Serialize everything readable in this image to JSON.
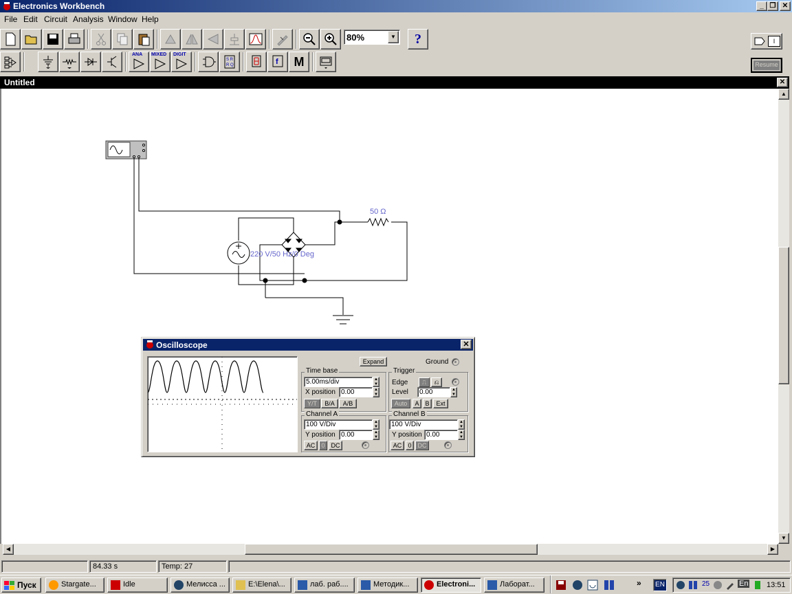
{
  "app": {
    "title": "Electronics Workbench"
  },
  "menu": [
    "File",
    "Edit",
    "Circuit",
    "Analysis",
    "Window",
    "Help"
  ],
  "toolbar": {
    "zoom": "80%",
    "help_label": "?",
    "resume_label": "Resume",
    "power_label": "I"
  },
  "parts_bin": {
    "analog_label": "ANA",
    "mixed_label": "MIXED",
    "digital_label": "DIGIT",
    "misc_label": "M"
  },
  "document": {
    "title": "Untitled"
  },
  "circuit": {
    "resistor_label": "50 Ω",
    "source_label": "220 V/50 Hz/0 Deg"
  },
  "oscilloscope": {
    "title": "Oscilloscope",
    "expand_label": "Expand",
    "ground_label": "Ground",
    "timebase": {
      "label": "Time base",
      "value": "5.00ms/div",
      "xpos_label": "X position",
      "xpos": "0.00",
      "modes": [
        "Y/T",
        "B/A",
        "A/B"
      ]
    },
    "trigger": {
      "label": "Trigger",
      "edge_label": "Edge",
      "level_label": "Level",
      "level": "0.00",
      "modes": [
        "Auto",
        "A",
        "B",
        "Ext"
      ]
    },
    "channel_a": {
      "label": "Channel A",
      "scale": "100  V/Div",
      "ypos_label": "Y position",
      "ypos": "0.00",
      "coupling": [
        "AC",
        "0",
        "DC"
      ]
    },
    "channel_b": {
      "label": "Channel B",
      "scale": "100  V/Div",
      "ypos_label": "Y position",
      "ypos": "0.00",
      "coupling": [
        "AC",
        "0",
        "DC"
      ]
    }
  },
  "status": {
    "time": "84.33 s",
    "temp": "Temp:  27"
  },
  "taskbar": {
    "start": "Пуск",
    "tasks": [
      "Stargate...",
      "Idle",
      "Мелисса ...",
      "E:\\Elena\\...",
      "лаб. раб....",
      "Методик...",
      "Electroni...",
      "Лаборат..."
    ],
    "lang": "EN",
    "tray_num": "25",
    "tray_lang": "En",
    "clock": "13:51"
  },
  "colors": {
    "title_active": "#0a246a",
    "circuit_label": "#6666cc",
    "desktop": "#d4d0c8"
  }
}
